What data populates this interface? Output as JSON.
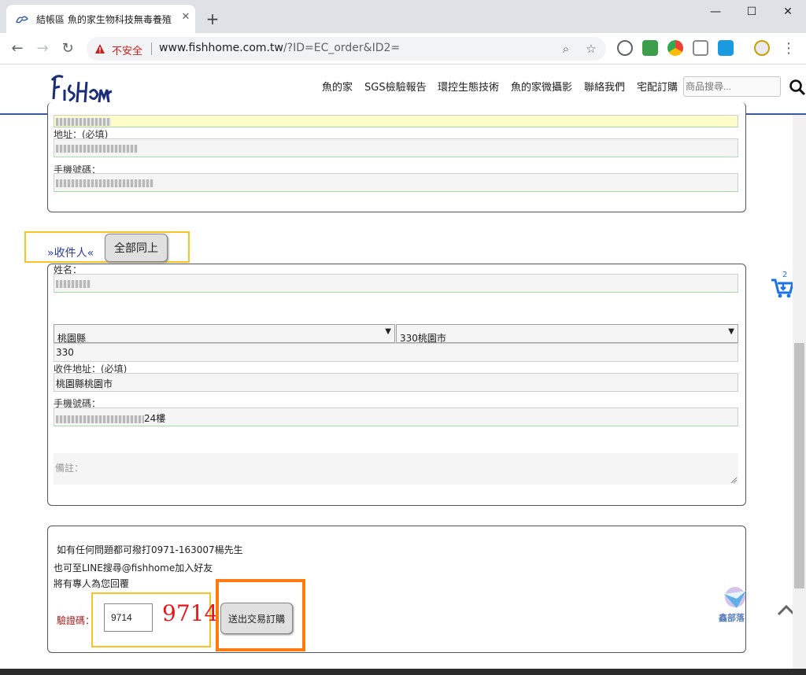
{
  "browser": {
    "tab_title": "結帳區 魚的家生物科技無毒養殖",
    "tab_close": "✕",
    "new_tab": "+",
    "not_secure": "不安全",
    "url_host": "www.fishhome.com.tw",
    "url_path": "/?ID=EC_order&ID2=",
    "window_minimize": "—",
    "window_maximize": "☐",
    "window_close": "✕"
  },
  "site": {
    "logo_text": "FishHome",
    "menu": [
      "魚的家",
      "SGS檢驗報告",
      "環控生態技術",
      "魚的家微攝影",
      "聯絡我們",
      "宅配訂購"
    ],
    "search_placeholder": "商品搜尋..."
  },
  "buyer": {
    "address_label": "地址：(必填)",
    "phone_label": "手機號碼："
  },
  "receiver": {
    "section_title": "»收件人«",
    "same_button": "全部同上",
    "name_label": "姓名：",
    "county": "桃園縣",
    "district": "330桃園市",
    "zip": "330",
    "address_label": "收件地址：(必填)",
    "address_value": "桃園縣桃園市",
    "phone_label": "手機號碼：",
    "phone_suffix": "24樓",
    "remark_placeholder": "備註："
  },
  "contact": {
    "line1": "如有任何問題都可撥打0971-163007楊先生",
    "line2": "也可至LINE搜尋@fishhome加入好友",
    "line3": "將有專人為您回覆"
  },
  "captcha": {
    "label": "驗證碼：",
    "input_value": "9714",
    "code": "9714"
  },
  "submit_label": "送出交易訂購",
  "cart_count": "2",
  "watermark_text": "鑫部落"
}
